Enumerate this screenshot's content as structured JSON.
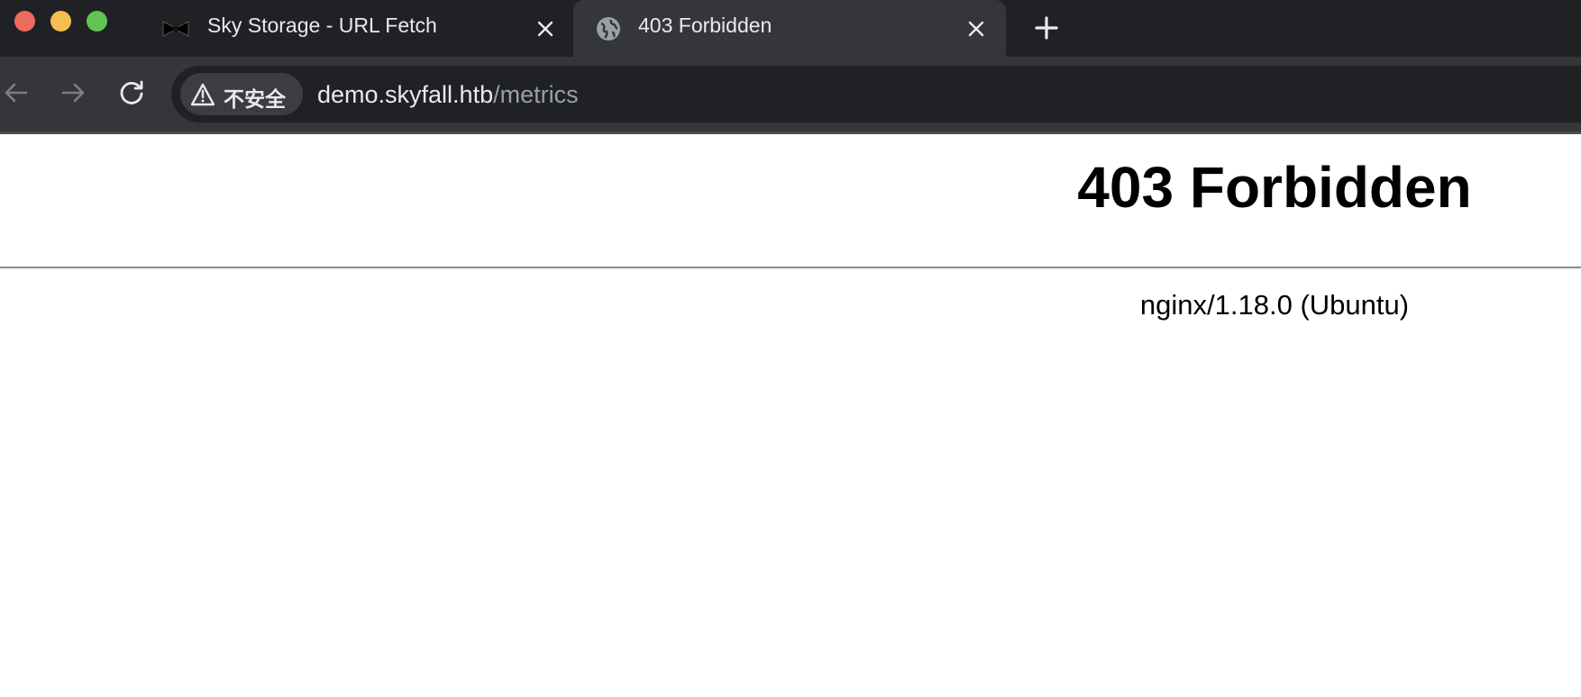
{
  "window": {
    "controls": [
      "close",
      "minimize",
      "maximize"
    ]
  },
  "tabs": [
    {
      "title": "Sky Storage - URL Fetch",
      "favicon": "bowtie-icon",
      "active": false
    },
    {
      "title": "403 Forbidden",
      "favicon": "globe-icon",
      "active": true
    }
  ],
  "toolbar": {
    "security_label": "不安全",
    "url_host": "demo.skyfall.htb",
    "url_path": "/metrics"
  },
  "page": {
    "heading": "403 Forbidden",
    "server_signature": "nginx/1.18.0 (Ubuntu)"
  },
  "colors": {
    "close": "#ed6a5e",
    "minimize": "#f5bf4f",
    "maximize": "#61c554",
    "tabstrip": "#202124",
    "toolbar": "#35363a"
  }
}
